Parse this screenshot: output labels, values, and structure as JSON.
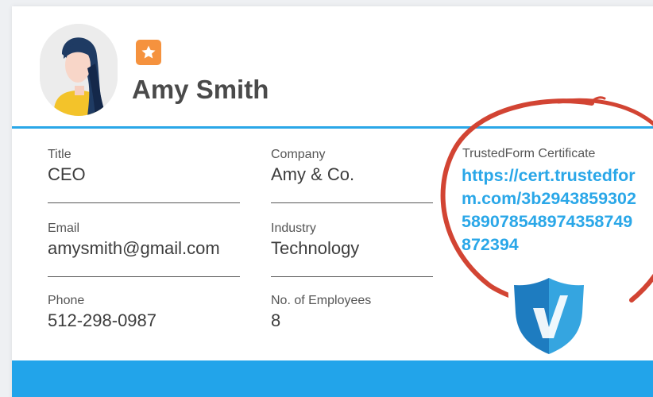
{
  "profile": {
    "name": "Amy Smith"
  },
  "fields": {
    "title": {
      "label": "Title",
      "value": "CEO"
    },
    "company": {
      "label": "Company",
      "value": "Amy & Co."
    },
    "email": {
      "label": "Email",
      "value": "amysmith@gmail.com"
    },
    "industry": {
      "label": "Industry",
      "value": "Technology"
    },
    "phone": {
      "label": "Phone",
      "value": "512-298-0987"
    },
    "employees": {
      "label": "No. of Employees",
      "value": "8"
    }
  },
  "certificate": {
    "label": "TrustedForm Certificate",
    "url": "https://cert.trustedform.com/3b2943859302589078548974358749872394"
  },
  "colors": {
    "accent": "#2aa7e8",
    "footer": "#22a4ea",
    "badge": "#f5923e",
    "circle": "#d24433"
  },
  "icons": {
    "favorite": "star-icon",
    "shield": "verified-shield-icon"
  }
}
